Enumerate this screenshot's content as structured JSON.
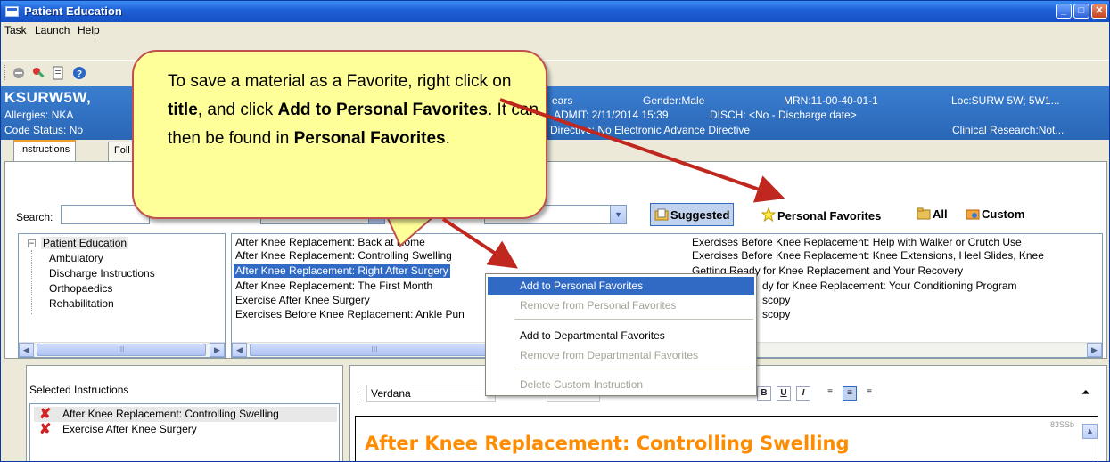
{
  "window": {
    "title": "Patient Education",
    "controls": [
      "minimize",
      "maximize",
      "close"
    ]
  },
  "menubar": {
    "items": [
      "Task",
      "Launch",
      "Help"
    ]
  },
  "toolbar": {
    "icons": [
      "stop-icon",
      "patient-search-icon",
      "document-icon",
      "help-icon"
    ]
  },
  "banner": {
    "patient_name": "KSURW5W,",
    "allergies": "Allergies: NKA",
    "code_status": "Code Status: No",
    "age": "ears",
    "gender": "Gender:Male",
    "mrn": "MRN:11-00-40-01-1",
    "loc": "Loc:SURW 5W; 5W1...",
    "admit": "ADMIT: 2/11/2014 15:39",
    "disch": "DISCH: <No - Discharge date>",
    "directive": "Directive: No Electronic Advance Directive",
    "clinical_research": "Clinical Research:Not..."
  },
  "tabs": [
    {
      "label": "Instructions",
      "active": true
    },
    {
      "label": "Foll",
      "active": false
    }
  ],
  "filters": {
    "search_label": "Search:",
    "toggles": [
      {
        "label": "Suggested",
        "icon": "folder-pages-icon",
        "selected": true
      },
      {
        "label": "Personal Favorites",
        "icon": "star-icon",
        "selected": false
      },
      {
        "label": "All",
        "icon": "folder-icon",
        "selected": false
      },
      {
        "label": "Custom",
        "icon": "custom-folder-icon",
        "selected": false
      }
    ]
  },
  "tree": {
    "root": "Patient Education",
    "children": [
      "Ambulatory",
      "Discharge Instructions",
      "Orthopaedics",
      "Rehabilitation"
    ]
  },
  "materials": {
    "column1": [
      "After Knee Replacement: Back at Home",
      "After Knee Replacement: Controlling Swelling",
      "After Knee Replacement: Right After Surgery",
      "After Knee Replacement: The First Month",
      "Exercise After Knee Surgery",
      "Exercises Before Knee Replacement: Ankle Pun"
    ],
    "selected_index": 2,
    "column2": [
      "Exercises Before Knee Replacement: Help with Walker or Crutch Use",
      "Exercises Before Knee Replacement: Knee Extensions, Heel Slides, Knee",
      "Getting Ready for Knee Replacement and Your Recovery",
      "dy for Knee Replacement: Your Conditioning Program",
      "scopy",
      "scopy"
    ]
  },
  "context_menu": {
    "items": [
      {
        "label": "Add to Personal Favorites",
        "enabled": true,
        "hover": true
      },
      {
        "label": "Remove from Personal Favorites",
        "enabled": false
      },
      {
        "label": "Add to Departmental Favorites",
        "enabled": true
      },
      {
        "label": "Remove from Departmental Favorites",
        "enabled": false
      },
      {
        "label": "Delete Custom Instruction",
        "enabled": false
      }
    ]
  },
  "selected_instructions": {
    "header": "Selected Instructions",
    "items": [
      "After Knee Replacement: Controlling Swelling",
      "Exercise After Knee Surgery"
    ]
  },
  "editor": {
    "font": "Verdana",
    "doc_code": "83SSb",
    "heading": "After Knee Replacement: Controlling Swelling",
    "heading_color": "#ff8c00",
    "format_buttons": [
      "B",
      "U",
      "I"
    ],
    "align_buttons": [
      "align-left",
      "align-center",
      "align-right"
    ],
    "active_align": "align-center"
  },
  "callout": {
    "part1": "To save a material as a Favorite, right click on ",
    "bold1": "title",
    "part2": ", and click ",
    "bold2": "Add to Personal Favorites",
    "part3": ". It can then be found in ",
    "bold3": "Personal Favorites",
    "part4": ".",
    "fill": "#ffff99",
    "border": "#c0504d"
  }
}
